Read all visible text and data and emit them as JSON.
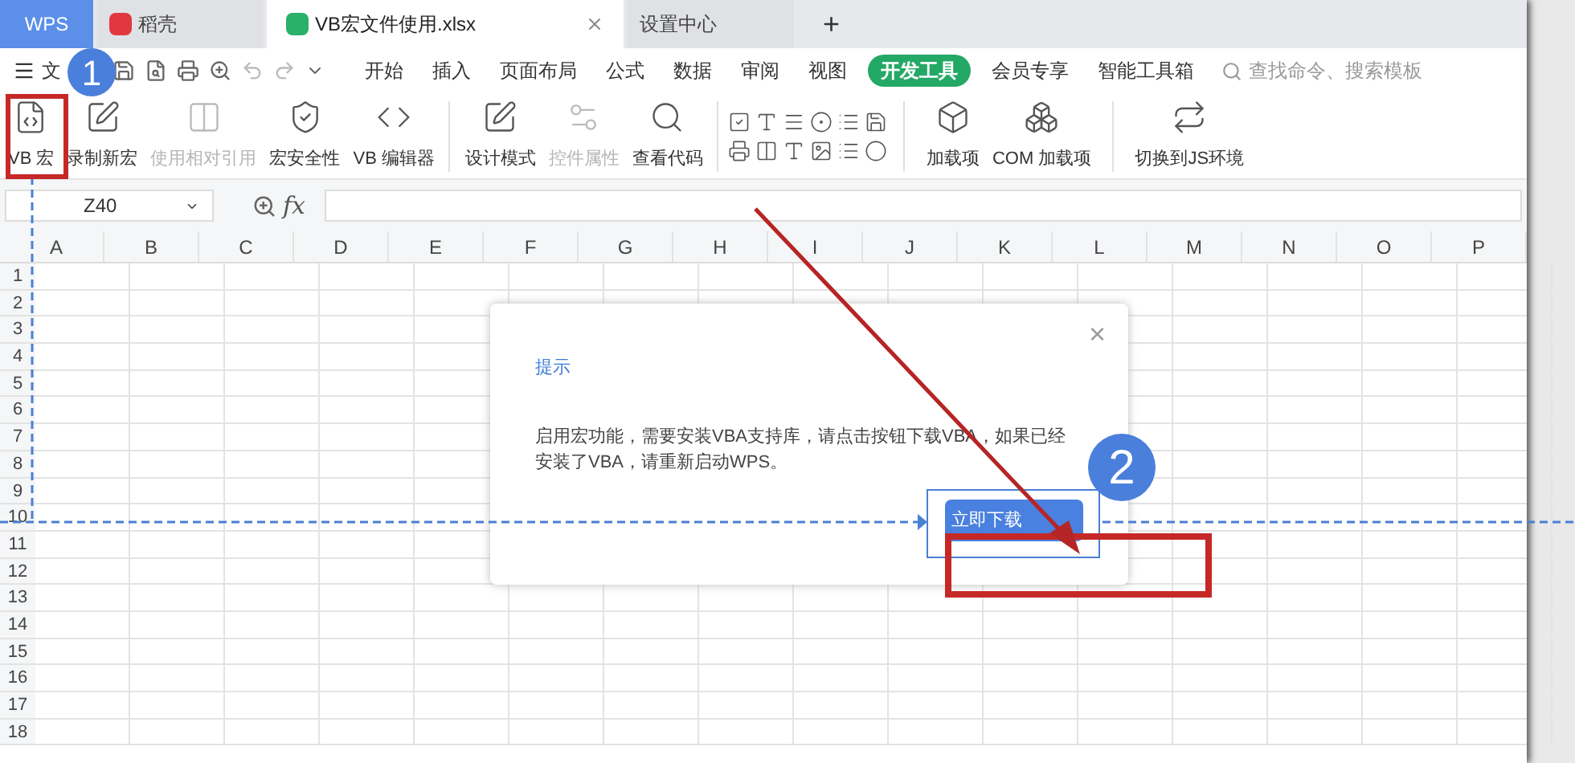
{
  "tabs": [
    {
      "label": "WPS",
      "kind": "brand",
      "selected": false
    },
    {
      "label": "稻壳",
      "kind": "docer",
      "selected": false
    },
    {
      "label": "VB宏文件使用.xlsx",
      "kind": "sheet",
      "selected": true
    },
    {
      "label": "设置中心",
      "kind": "plain",
      "selected": false
    }
  ],
  "new_tab": "+",
  "menu": {
    "file": "文",
    "items": [
      {
        "label": "开始",
        "selected": false
      },
      {
        "label": "插入",
        "selected": false
      },
      {
        "label": "页面布局",
        "selected": false
      },
      {
        "label": "公式",
        "selected": false
      },
      {
        "label": "数据",
        "selected": false
      },
      {
        "label": "审阅",
        "selected": false
      },
      {
        "label": "视图",
        "selected": false
      },
      {
        "label": "开发工具",
        "selected": true
      },
      {
        "label": "会员专享",
        "selected": false
      },
      {
        "label": "智能工具箱",
        "selected": false
      }
    ],
    "search": {
      "placeholder": "查找命令、搜索模板"
    }
  },
  "ribbon": [
    {
      "label": "VB 宏",
      "kind": "macro",
      "disabled": false
    },
    {
      "label": "录制新宏",
      "kind": "record",
      "disabled": false
    },
    {
      "label": "使用相对引用",
      "kind": "relative",
      "disabled": true
    },
    {
      "label": "宏安全性",
      "kind": "security",
      "disabled": false
    },
    {
      "label": "VB 编辑器",
      "kind": "editor",
      "disabled": false
    },
    {
      "label": "设计模式",
      "kind": "design",
      "disabled": false
    },
    {
      "label": "控件属性",
      "kind": "properties",
      "disabled": true
    },
    {
      "label": "查看代码",
      "kind": "code",
      "disabled": false
    },
    {
      "label": "加载项",
      "kind": "addin",
      "disabled": false
    },
    {
      "label": "COM 加载项",
      "kind": "comaddin",
      "disabled": false
    },
    {
      "label": "切换到JS环境",
      "kind": "js",
      "disabled": false
    }
  ],
  "formula_bar": {
    "name_box": "Z40",
    "fx": "fx"
  },
  "columns": [
    "A",
    "B",
    "C",
    "D",
    "E",
    "F",
    "G",
    "H",
    "I",
    "J",
    "K",
    "L",
    "M",
    "N",
    "O",
    "P"
  ],
  "rows": [
    "1",
    "2",
    "3",
    "4",
    "5",
    "6",
    "7",
    "8",
    "9",
    "10",
    "11",
    "12",
    "13",
    "14",
    "15",
    "16",
    "17",
    "18"
  ],
  "dialog": {
    "title": "提示",
    "close": "×",
    "message": "启用宏功能，需要安装VBA支持库，请点击按钮下载VBA，如果已经安装了VBA，请重新启动WPS。",
    "button": "立即下载"
  },
  "callouts": [
    "1",
    "2"
  ]
}
